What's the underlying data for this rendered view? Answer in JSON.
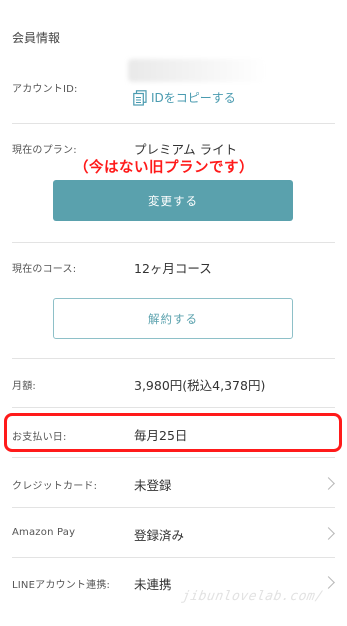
{
  "section_title": "会員情報",
  "account": {
    "label": "アカウントID:",
    "copy_label": "IDをコピーする",
    "copy_icon": "copy-document-icon"
  },
  "plan": {
    "label": "現在のプラン:",
    "value": "プレミアム ライト",
    "annotation": "（今はない旧プランです）",
    "change_button": "変更する"
  },
  "course": {
    "label": "現在のコース:",
    "value": "12ヶ月コース",
    "cancel_button": "解約する"
  },
  "monthly": {
    "label": "月額:",
    "value": "3,980円(税込4,378円)"
  },
  "payment_day": {
    "label": "お支払い日:",
    "value": "毎月25日",
    "highlight_color": "#ff1a1a"
  },
  "rows": [
    {
      "label": "クレジットカード:",
      "value": "未登録"
    },
    {
      "label": "Amazon Pay",
      "value": "登録済み"
    },
    {
      "label": "LINEアカウント連携:",
      "value": "未連携"
    }
  ],
  "watermark": "jibunlovelab.com/",
  "colors": {
    "accent": "#5aa1ad",
    "link": "#4a9bb0",
    "annotation": "#ff1a1a"
  }
}
